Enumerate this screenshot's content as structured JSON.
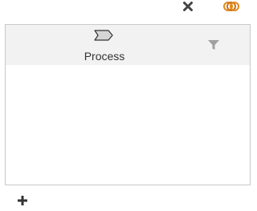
{
  "toolbar": {
    "close_icon": "close-icon",
    "linked_rings_icon": "linked-rings-icon"
  },
  "panel": {
    "header": {
      "icon": "process-chevron-icon",
      "label": "Process",
      "filter_icon": "filter-icon"
    },
    "body": {
      "items": []
    }
  },
  "footer": {
    "add_icon": "add-icon"
  },
  "colors": {
    "header_bg": "#f2f2f2",
    "border": "#c9c9c9",
    "icon_dark": "#3a3a3a",
    "icon_muted": "#9e9e9e",
    "rings_orange": "#e08a1e"
  }
}
